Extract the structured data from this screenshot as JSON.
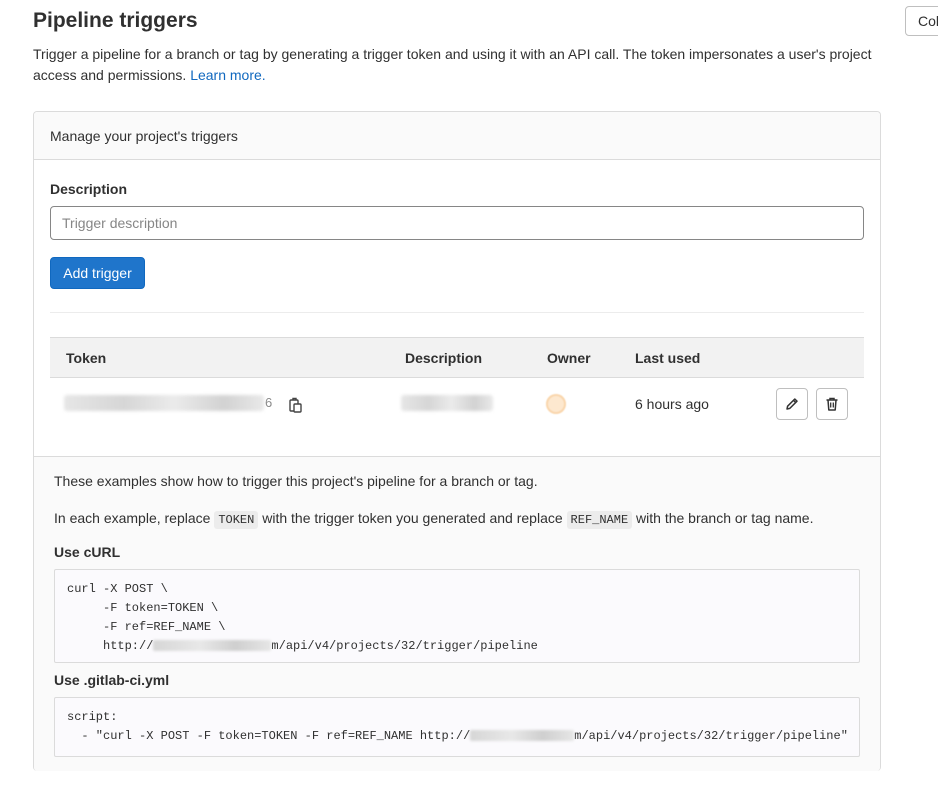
{
  "page": {
    "title": "Pipeline triggers",
    "collapse_label": "Collapse",
    "intro_text": "Trigger a pipeline for a branch or tag by generating a trigger token and using it with an API call. The token impersonates a user's project access and permissions.",
    "learn_more": "Learn more."
  },
  "card": {
    "header": "Manage your project's triggers",
    "form": {
      "description_label": "Description",
      "description_placeholder": "Trigger description",
      "description_value": "",
      "add_button": "Add trigger"
    },
    "table": {
      "columns": [
        "Token",
        "Description",
        "Owner",
        "Last used"
      ],
      "rows": [
        {
          "token_suffix": "6",
          "last_used": "6 hours ago"
        }
      ]
    }
  },
  "examples": {
    "intro": "These examples show how to trigger this project's pipeline for a branch or tag.",
    "replace_part1": "In each example, replace",
    "replace_code1": "TOKEN",
    "replace_part2": "with the trigger token you generated and replace",
    "replace_code2": "REF_NAME",
    "replace_part3": "with the branch or tag name.",
    "curl_heading": "Use cURL",
    "curl_lines": [
      "curl -X POST \\",
      "     -F token=TOKEN \\",
      "     -F ref=REF_NAME \\",
      "     http://"
    ],
    "curl_url_tail": "m/api/v4/projects/32/trigger/pipeline",
    "yml_heading": "Use .gitlab-ci.yml",
    "yml_line1": "script:",
    "yml_line2_prefix": "  - \"curl -X POST -F token=TOKEN -F ref=REF_NAME http://",
    "yml_url_tail": "m/api/v4/projects/32/trigger/pipeline\""
  },
  "icons": {
    "copy": "copy-icon",
    "edit": "pencil-icon",
    "delete": "trash-icon"
  },
  "colors": {
    "primary": "#1f75cb",
    "link": "#1068bf",
    "border": "#dbdbdb"
  }
}
